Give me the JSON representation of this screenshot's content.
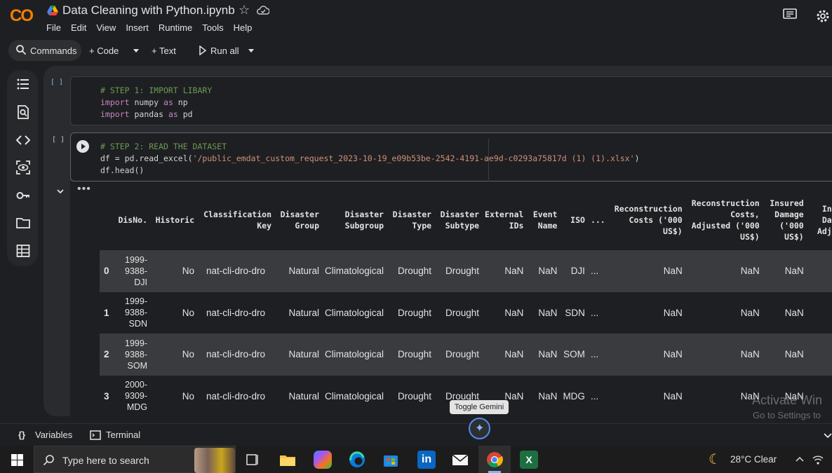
{
  "app": {
    "logo_text": "CO",
    "notebook_title": "Data Cleaning with Python.ipynb",
    "menu": [
      "File",
      "Edit",
      "View",
      "Insert",
      "Runtime",
      "Tools",
      "Help"
    ]
  },
  "toolbar": {
    "commands_label": "Commands",
    "code_label": "+ Code",
    "text_label": "+ Text",
    "run_all_label": "Run all"
  },
  "cells": [
    {
      "exec_count": "[ ]",
      "lines": [
        {
          "kind": "comment",
          "text": "# STEP 1: IMPORT LIBARY"
        },
        {
          "kind": "import",
          "kw1": "import",
          "rest": " numpy ",
          "kw2": "as",
          "rest2": " np"
        },
        {
          "kind": "import",
          "kw1": "import",
          "rest": " pandas ",
          "kw2": "as",
          "rest2": " pd"
        }
      ]
    },
    {
      "exec_count": "[ ]",
      "line1": "# STEP 2: READ THE DATASET",
      "line2_pre": "df = pd.read_excel(",
      "line2_str": "'/public_emdat_custom_request_2023-10-19_e09b53be-2542-4191-ae9d-c0293a75817d (1) (1).xlsx'",
      "line2_post": ")",
      "line3": "df.head()"
    }
  ],
  "output": {
    "ellipsis_icon": "more-horiz",
    "headers": [
      "",
      "DisNo.",
      "Historic",
      "Classification\nKey",
      "Disaster\nGroup",
      "Disaster\nSubgroup",
      "Disaster\nType",
      "Disaster\nSubtype",
      "External\nIDs",
      "Event\nName",
      "ISO",
      "...",
      "Reconstruction\nCosts ('000\nUS$)",
      "Reconstruction\nCosts,\nAdjusted ('000\nUS$)",
      "Insured\nDamage\n('000\nUS$)",
      "In\nDa\nAdj"
    ],
    "rows": [
      [
        "0",
        "1999-\n9388-\nDJI",
        "No",
        "nat-cli-dro-dro",
        "Natural",
        "Climatological",
        "Drought",
        "Drought",
        "NaN",
        "NaN",
        "DJI",
        "...",
        "NaN",
        "NaN",
        "NaN",
        ""
      ],
      [
        "1",
        "1999-\n9388-\nSDN",
        "No",
        "nat-cli-dro-dro",
        "Natural",
        "Climatological",
        "Drought",
        "Drought",
        "NaN",
        "NaN",
        "SDN",
        "...",
        "NaN",
        "NaN",
        "NaN",
        ""
      ],
      [
        "2",
        "1999-\n9388-\nSOM",
        "No",
        "nat-cli-dro-dro",
        "Natural",
        "Climatological",
        "Drought",
        "Drought",
        "NaN",
        "NaN",
        "SOM",
        "...",
        "NaN",
        "NaN",
        "NaN",
        ""
      ],
      [
        "3",
        "2000-\n9309-\nMDG",
        "No",
        "nat-cli-dro-dro",
        "Natural",
        "Climatological",
        "Drought",
        "Drought",
        "NaN",
        "NaN",
        "MDG",
        "...",
        "NaN",
        "NaN",
        "NaN",
        ""
      ]
    ]
  },
  "bottom": {
    "variables_label": "Variables",
    "terminal_label": "Terminal",
    "tooltip": "Toggle Gemini",
    "watermark_line1": "Activate Win",
    "watermark_line2": "Go to Settings to"
  },
  "taskbar": {
    "search_placeholder": "Type here to search",
    "weather": "28°C  Clear"
  }
}
